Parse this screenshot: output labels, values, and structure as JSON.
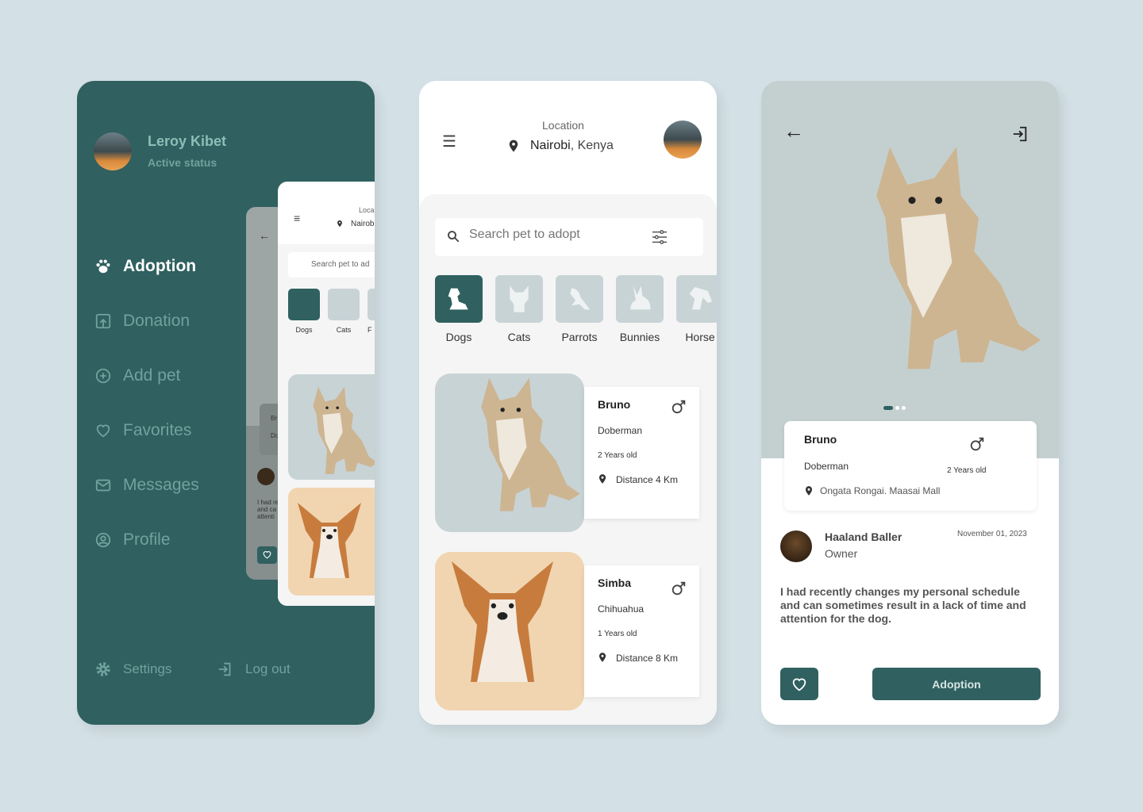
{
  "colors": {
    "background": "#d3e0e5",
    "primary": "#306060",
    "sidebar_text": "#6fa39d",
    "image_bg": "#c8d3d6"
  },
  "sidebar": {
    "user_name": "Leroy Kibet",
    "user_status": "Active status",
    "items": [
      {
        "label": "Adoption",
        "icon": "paw-icon",
        "active": true
      },
      {
        "label": "Donation",
        "icon": "donation-icon"
      },
      {
        "label": "Add pet",
        "icon": "plus-circle-icon"
      },
      {
        "label": "Favorites",
        "icon": "heart-icon"
      },
      {
        "label": "Messages",
        "icon": "mail-icon"
      },
      {
        "label": "Profile",
        "icon": "user-circle-icon"
      }
    ],
    "settings_label": "Settings",
    "logout_label": "Log out",
    "preview": {
      "location_label": "Loca",
      "location_value": "Nairob",
      "search": "Search pet to ad",
      "cats": [
        "Dogs",
        "Cats",
        "F"
      ],
      "card_name": "Br",
      "card_breed": "Do",
      "text": [
        "I had re",
        "and ca",
        "attenti"
      ]
    }
  },
  "home": {
    "location_label": "Location",
    "location_city": "Nairobi",
    "location_country": ", Kenya",
    "search_placeholder": "Search pet to adopt",
    "categories": [
      {
        "label": "Dogs",
        "selected": true
      },
      {
        "label": "Cats"
      },
      {
        "label": "Parrots"
      },
      {
        "label": "Bunnies"
      },
      {
        "label": "Horse"
      }
    ],
    "pets": [
      {
        "name": "Bruno",
        "breed": "Doberman",
        "age": "2 Years old",
        "distance": "Distance 4 Km"
      },
      {
        "name": "Simba",
        "breed": "Chihuahua",
        "age": "1 Years old",
        "distance": "Distance 8 Km"
      }
    ]
  },
  "detail": {
    "name": "Bruno",
    "breed": "Doberman",
    "age": "2 Years old",
    "location": "Ongata Rongai. Maasai Mall",
    "owner_name": "Haaland Baller",
    "owner_role": "Owner",
    "date": "November 01, 2023",
    "description": "I had recently changes my  personal schedule and  can sometimes result in a lack of time and attention for the dog.",
    "adopt_label": "Adoption",
    "carousel_active": 0,
    "carousel_count": 3
  }
}
